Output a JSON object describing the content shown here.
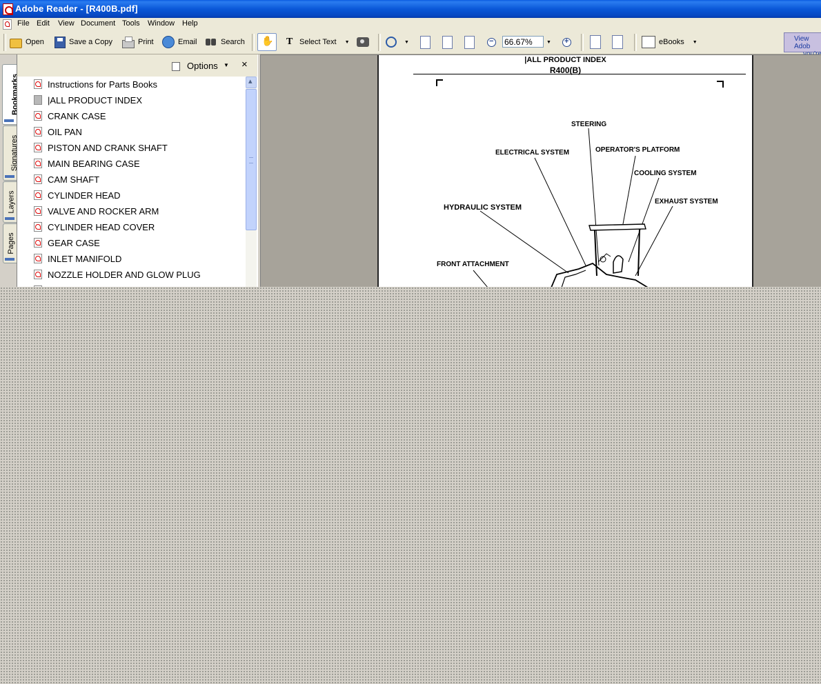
{
  "window": {
    "title": "Adobe Reader - [R400B.pdf]"
  },
  "menu": [
    "File",
    "Edit",
    "View",
    "Document",
    "Tools",
    "Window",
    "Help"
  ],
  "toolbar": {
    "open_label": "Open",
    "save_copy_label": "Save a Copy",
    "print_label": "Print",
    "email_label": "Email",
    "search_label": "Search",
    "select_text_label": "Select Text",
    "zoom_value": "66.67%",
    "ebooks_label": "eBooks",
    "ad_text_1": "View Adob",
    "ad_text_2": "you're"
  },
  "nav_tabs": [
    "Bookmarks",
    "Signatures",
    "Layers",
    "Pages"
  ],
  "panel": {
    "options_label": "Options",
    "close_label": "×"
  },
  "bookmarks": [
    "Instructions for Parts Books",
    "|ALL PRODUCT INDEX",
    "CRANK CASE",
    "OIL PAN",
    "PISTON AND CRANK SHAFT",
    "MAIN BEARING CASE",
    "CAM SHAFT",
    "CYLINDER HEAD",
    "VALVE AND ROCKER ARM",
    "CYLINDER HEAD COVER",
    "GEAR CASE",
    "INLET MANIFOLD",
    "NOZZLE HOLDER AND GLOW PLUG"
  ],
  "document": {
    "header_title": "|ALL PRODUCT INDEX",
    "header_model": "R400(B)",
    "labels": {
      "steering": "STEERING",
      "electrical": "ELECTRICAL SYSTEM",
      "operator": "OPERATOR'S PLATFORM",
      "cooling": "COOLING SYSTEM",
      "exhaust": "EXHAUST SYSTEM",
      "hydraulic": "HYDRAULIC SYSTEM",
      "front": "FRONT ATTACHMENT"
    }
  }
}
